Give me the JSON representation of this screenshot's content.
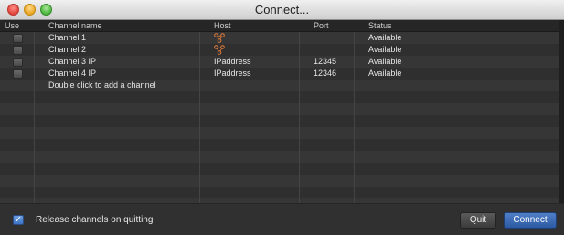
{
  "window": {
    "title": "Connect..."
  },
  "table": {
    "headers": {
      "use": "Use",
      "channel": "Channel name",
      "host": "Host",
      "port": "Port",
      "status": "Status"
    },
    "rows": [
      {
        "channel": "Channel 1",
        "host": "",
        "host_icon": "graph-node-icon",
        "port": "",
        "status": "Available"
      },
      {
        "channel": "Channel 2",
        "host": "",
        "host_icon": "graph-node-icon",
        "port": "",
        "status": "Available"
      },
      {
        "channel": "Channel 3 IP",
        "host": "IPaddress",
        "port": "12345",
        "status": "Available"
      },
      {
        "channel": "Channel 4 IP",
        "host": "IPaddress",
        "port": "12346",
        "status": "Available"
      }
    ],
    "add_row_text": "Double click to add a channel"
  },
  "footer": {
    "release_label": "Release channels on quitting",
    "release_checked": true,
    "quit_label": "Quit",
    "connect_label": "Connect"
  },
  "colors": {
    "accent": "#3f74c4",
    "host_icon": "#e07a3a"
  }
}
